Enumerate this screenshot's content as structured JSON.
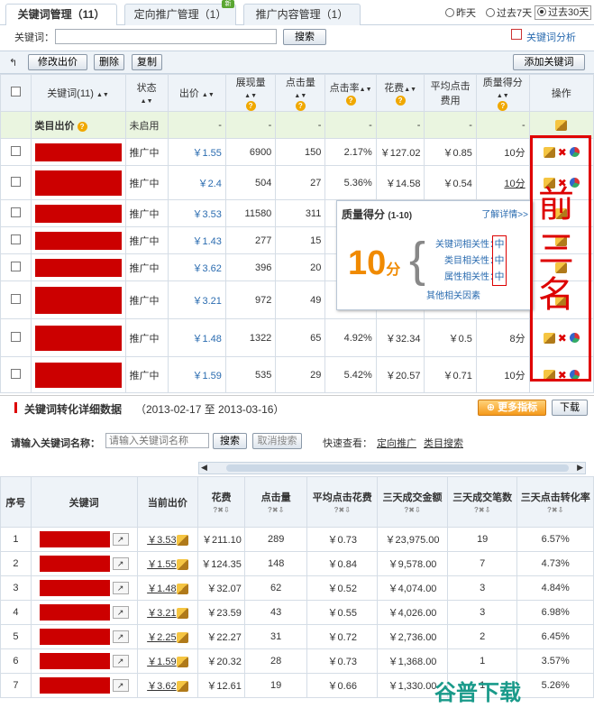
{
  "tabs": [
    {
      "label": "关键词管理（11）"
    },
    {
      "label": "定向推广管理（1）"
    },
    {
      "label": "推广内容管理（1）"
    }
  ],
  "tab_badge": "新",
  "date_filter": {
    "options": [
      "昨天",
      "过去7天",
      "过去30天"
    ],
    "selected": "过去30天"
  },
  "search": {
    "label": "关键词：",
    "value": "",
    "button": "搜索",
    "analysis_link": "关键词分析"
  },
  "toolbar": {
    "edit_bid": "修改出价",
    "delete": "删除",
    "copy": "复制",
    "add_keyword": "添加关键词"
  },
  "table": {
    "headers": [
      "关键词(11)",
      "状态",
      "出价",
      "展现量",
      "点击量",
      "点击率",
      "花费",
      "平均点击费用",
      "质量得分",
      "操作"
    ],
    "category_row": {
      "name": "类目出价",
      "status": "未启用",
      "dash": "-"
    },
    "rows": [
      {
        "status": "推广中",
        "bid": "￥1.55",
        "impr": "6900",
        "clicks": "150",
        "ctr": "2.17%",
        "cost": "￥127.02",
        "avg": "￥0.85",
        "score": "10分"
      },
      {
        "status": "推广中",
        "bid": "￥2.4",
        "impr": "504",
        "clicks": "27",
        "ctr": "5.36%",
        "cost": "￥14.58",
        "avg": "￥0.54",
        "score": "10分"
      },
      {
        "status": "推广中",
        "bid": "￥3.53",
        "impr": "11580",
        "clicks": "311",
        "ctr": "",
        "cost": "",
        "avg": "",
        "score": ""
      },
      {
        "status": "推广中",
        "bid": "￥1.43",
        "impr": "277",
        "clicks": "15",
        "ctr": "",
        "cost": "",
        "avg": "",
        "score": ""
      },
      {
        "status": "推广中",
        "bid": "￥3.62",
        "impr": "396",
        "clicks": "20",
        "ctr": "",
        "cost": "",
        "avg": "",
        "score": ""
      },
      {
        "status": "推广中",
        "bid": "￥3.21",
        "impr": "972",
        "clicks": "49",
        "ctr": "",
        "cost": "",
        "avg": "",
        "score": ""
      },
      {
        "status": "推广中",
        "bid": "￥1.48",
        "impr": "1322",
        "clicks": "65",
        "ctr": "4.92%",
        "cost": "￥32.34",
        "avg": "￥0.5",
        "score": "8分"
      },
      {
        "status": "推广中",
        "bid": "￥1.59",
        "impr": "535",
        "clips": "",
        "clicks": "29",
        "ctr": "5.42%",
        "cost": "￥20.57",
        "avg": "￥0.71",
        "score": "10分"
      }
    ]
  },
  "quality_popup": {
    "title": "质量得分",
    "range": "(1-10)",
    "more": "了解详情>>",
    "score": "10",
    "unit": "分",
    "items": [
      {
        "label": "关键词相关性：",
        "value": "中"
      },
      {
        "label": "类目相关性：",
        "value": "中"
      },
      {
        "label": "属性相关性：",
        "value": "中"
      }
    ],
    "other": "其他相关因素"
  },
  "annotation": [
    "前",
    "三",
    "名"
  ],
  "section2": {
    "title": "关键词转化详细数据",
    "daterange": "（2013-02-17 至 2013-03-16）",
    "more_metrics": "更多指标",
    "download": "下载",
    "search_label": "请输入关键词名称：",
    "search_placeholder": "请输入关键词名称",
    "search_btn": "搜索",
    "cancel_btn": "取消搜索",
    "quick_label": "快速查看：",
    "quick_links": [
      "定向推广",
      "类目搜索"
    ]
  },
  "table2": {
    "headers": [
      "序号",
      "关键词",
      "当前出价",
      "花费",
      "点击量",
      "平均点击花费",
      "三天成交金额",
      "三天成交笔数",
      "三天点击转化率"
    ],
    "rows": [
      [
        "1",
        "￥3.53",
        "￥211.10",
        "289",
        "￥0.73",
        "￥23,975.00",
        "19",
        "6.57%"
      ],
      [
        "2",
        "￥1.55",
        "￥124.35",
        "148",
        "￥0.84",
        "￥9,578.00",
        "7",
        "4.73%"
      ],
      [
        "3",
        "￥1.48",
        "￥32.07",
        "62",
        "￥0.52",
        "￥4,074.00",
        "3",
        "4.84%"
      ],
      [
        "4",
        "￥3.21",
        "￥23.59",
        "43",
        "￥0.55",
        "￥4,026.00",
        "3",
        "6.98%"
      ],
      [
        "5",
        "￥2.25",
        "￥22.27",
        "31",
        "￥0.72",
        "￥2,736.00",
        "2",
        "6.45%"
      ],
      [
        "6",
        "￥1.59",
        "￥20.32",
        "28",
        "￥0.73",
        "￥1,368.00",
        "1",
        "3.57%"
      ],
      [
        "7",
        "￥3.62",
        "￥12.61",
        "19",
        "￥0.66",
        "￥1,330.00",
        "1",
        "5.26%"
      ]
    ]
  },
  "watermark": "谷普下载"
}
